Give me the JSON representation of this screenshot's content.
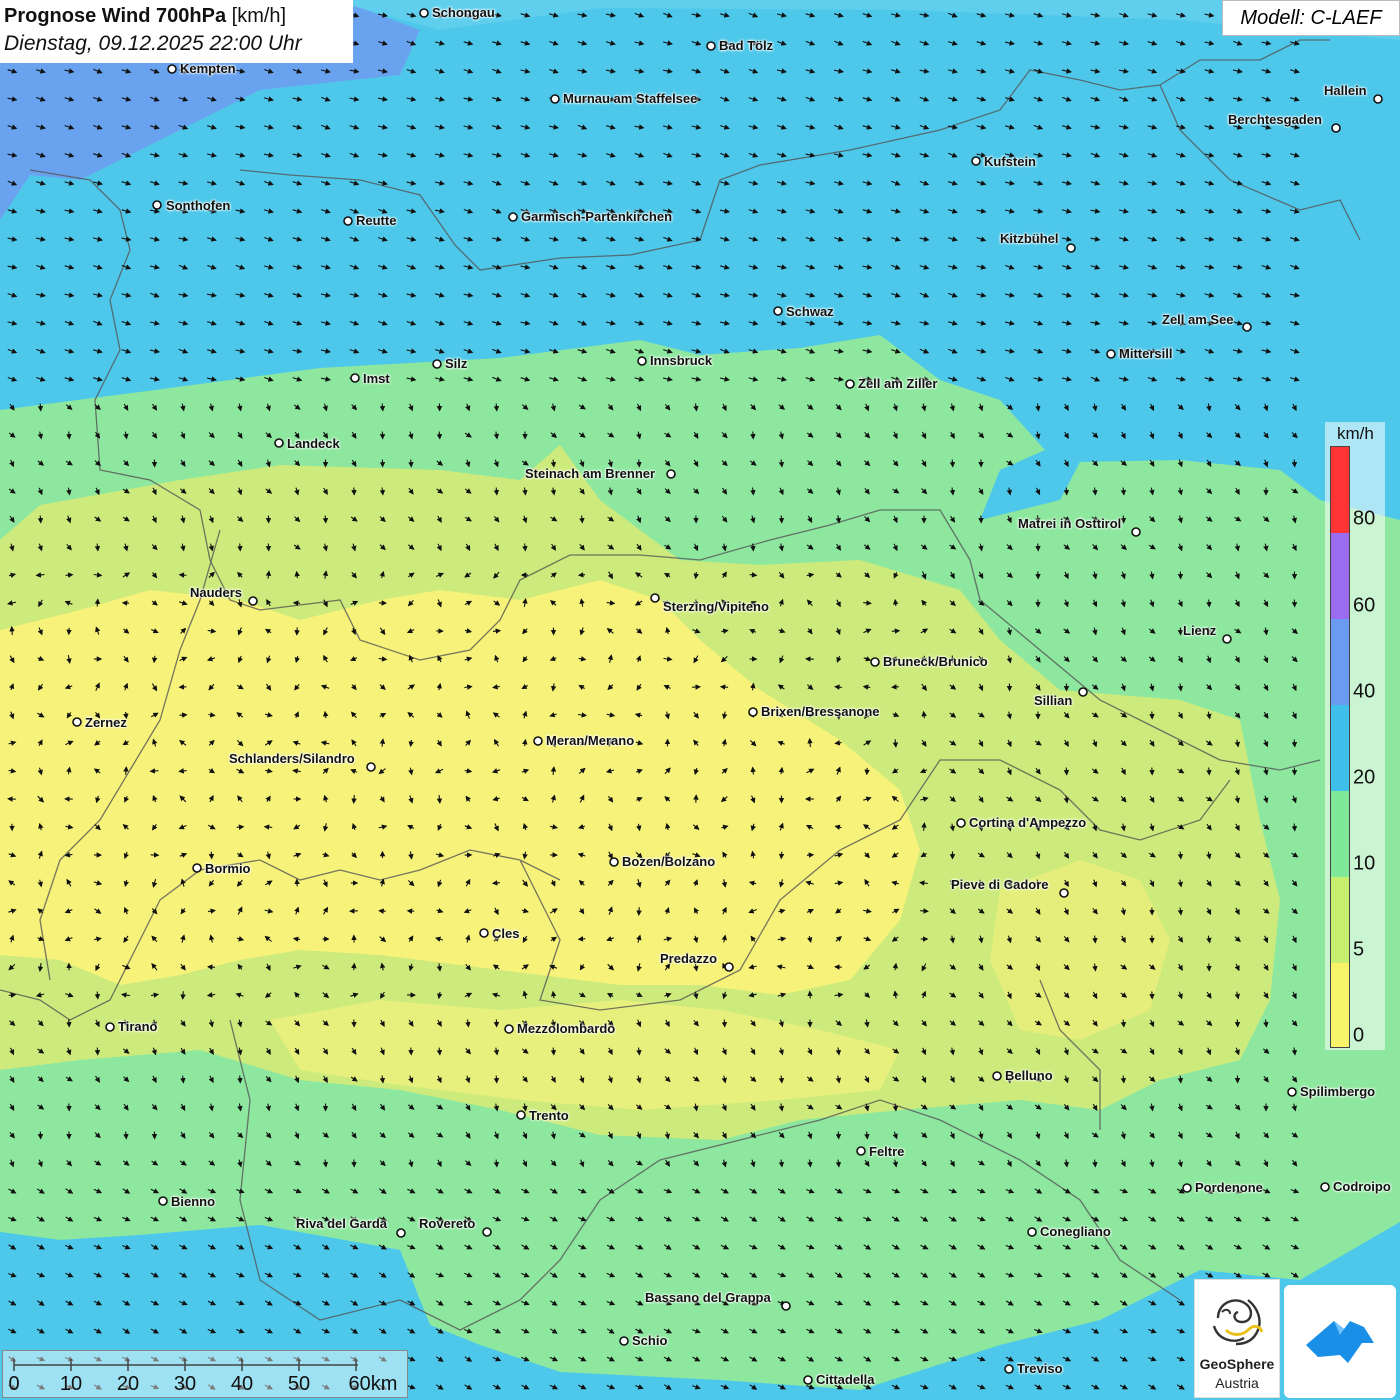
{
  "title": {
    "main_bold": "Prognose Wind 700hPa",
    "main_unit": "[km/h]",
    "date": "Dienstag, 09.12.2025 22:00 Uhr"
  },
  "model": "Modell: C-LAEF",
  "legend": {
    "unit": "km/h",
    "ticks": [
      "80",
      "60",
      "40",
      "20",
      "10",
      "5",
      "0"
    ],
    "colors": [
      "#ff3535",
      "#9b6cf0",
      "#6a9bf0",
      "#3fc0ea",
      "#7fe99a",
      "#c8f070",
      "#f8f46a"
    ]
  },
  "scalebar": {
    "labels": [
      "0",
      "10",
      "20",
      "30",
      "40",
      "50",
      "60km"
    ]
  },
  "logo": {
    "name": "GeoSphere",
    "sub": "Austria"
  },
  "colors": {
    "zone_0_5": "#f6f27a",
    "zone_5_10": "#cdeb7c",
    "zone_10_20": "#8de79e",
    "zone_20_40": "#4ec8ea",
    "zone_40_60": "#6e9cf0",
    "arrow": "#111111",
    "border": "#555555"
  },
  "cities": [
    {
      "name": "Schongau"
    },
    {
      "name": "Bad Tölz"
    },
    {
      "name": "Kempten"
    },
    {
      "name": "Murnau am Staffelsee"
    },
    {
      "name": "Hallein"
    },
    {
      "name": "Berchtesgaden"
    },
    {
      "name": "Kufstein"
    },
    {
      "name": "Sonthofen"
    },
    {
      "name": "Reutte"
    },
    {
      "name": "Garmisch-Partenkirchen"
    },
    {
      "name": "Kitzbühel"
    },
    {
      "name": "Schwaz"
    },
    {
      "name": "Zell am See"
    },
    {
      "name": "Mittersill"
    },
    {
      "name": "Innsbruck"
    },
    {
      "name": "Silz"
    },
    {
      "name": "Imst"
    },
    {
      "name": "Zell am Ziller"
    },
    {
      "name": "Landeck"
    },
    {
      "name": "Steinach am Brenner"
    },
    {
      "name": "Matrei in Osttirol"
    },
    {
      "name": "Nauders"
    },
    {
      "name": "Sterzing/Vipiteno"
    },
    {
      "name": "Lienz"
    },
    {
      "name": "Bruneck/Brunico"
    },
    {
      "name": "Sillian"
    },
    {
      "name": "Brixen/Bressanone"
    },
    {
      "name": "Zernez"
    },
    {
      "name": "Meran/Merano"
    },
    {
      "name": "Schlanders/Silandro"
    },
    {
      "name": "Cortina d'Ampezzo"
    },
    {
      "name": "Bozen/Bolzano"
    },
    {
      "name": "Bormio"
    },
    {
      "name": "Pieve di Cadore"
    },
    {
      "name": "Cles"
    },
    {
      "name": "Predazzo"
    },
    {
      "name": "Tirano"
    },
    {
      "name": "Mezzolombardo"
    },
    {
      "name": "Belluno"
    },
    {
      "name": "Spilimbergo"
    },
    {
      "name": "Trento"
    },
    {
      "name": "Feltre"
    },
    {
      "name": "Bienno"
    },
    {
      "name": "Pordenone"
    },
    {
      "name": "Codroipo"
    },
    {
      "name": "Riva del Garda"
    },
    {
      "name": "Rovereto"
    },
    {
      "name": "Conegliano"
    },
    {
      "name": "Bassano del Grappa"
    },
    {
      "name": "Schio"
    },
    {
      "name": "Treviso"
    },
    {
      "name": "Cittadella"
    }
  ]
}
